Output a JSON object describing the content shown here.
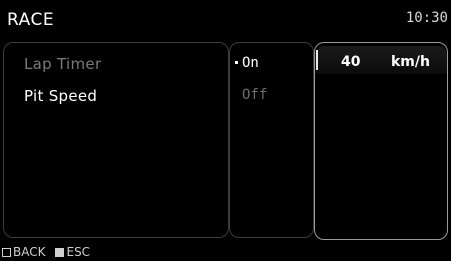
{
  "header": {
    "title": "RACE",
    "clock": "10:30"
  },
  "menu": {
    "items": [
      {
        "label": "Lap Timer",
        "state": "dim"
      },
      {
        "label": "Pit Speed",
        "state": "selected"
      }
    ]
  },
  "options": {
    "items": [
      {
        "label": "On",
        "active": true
      },
      {
        "label": "Off",
        "active": false
      }
    ]
  },
  "value_panel": {
    "value": "40",
    "unit": "km/h"
  },
  "footer": {
    "back": {
      "label": "BACK",
      "icon": "outline-square-icon"
    },
    "esc": {
      "label": "ESC",
      "icon": "filled-square-icon"
    }
  },
  "colors": {
    "background": "#000000",
    "text": "#ffffff",
    "dim_text": "#7a7a7a",
    "panel_border": "#3c3c3c",
    "active_border": "#9a9a9a"
  }
}
